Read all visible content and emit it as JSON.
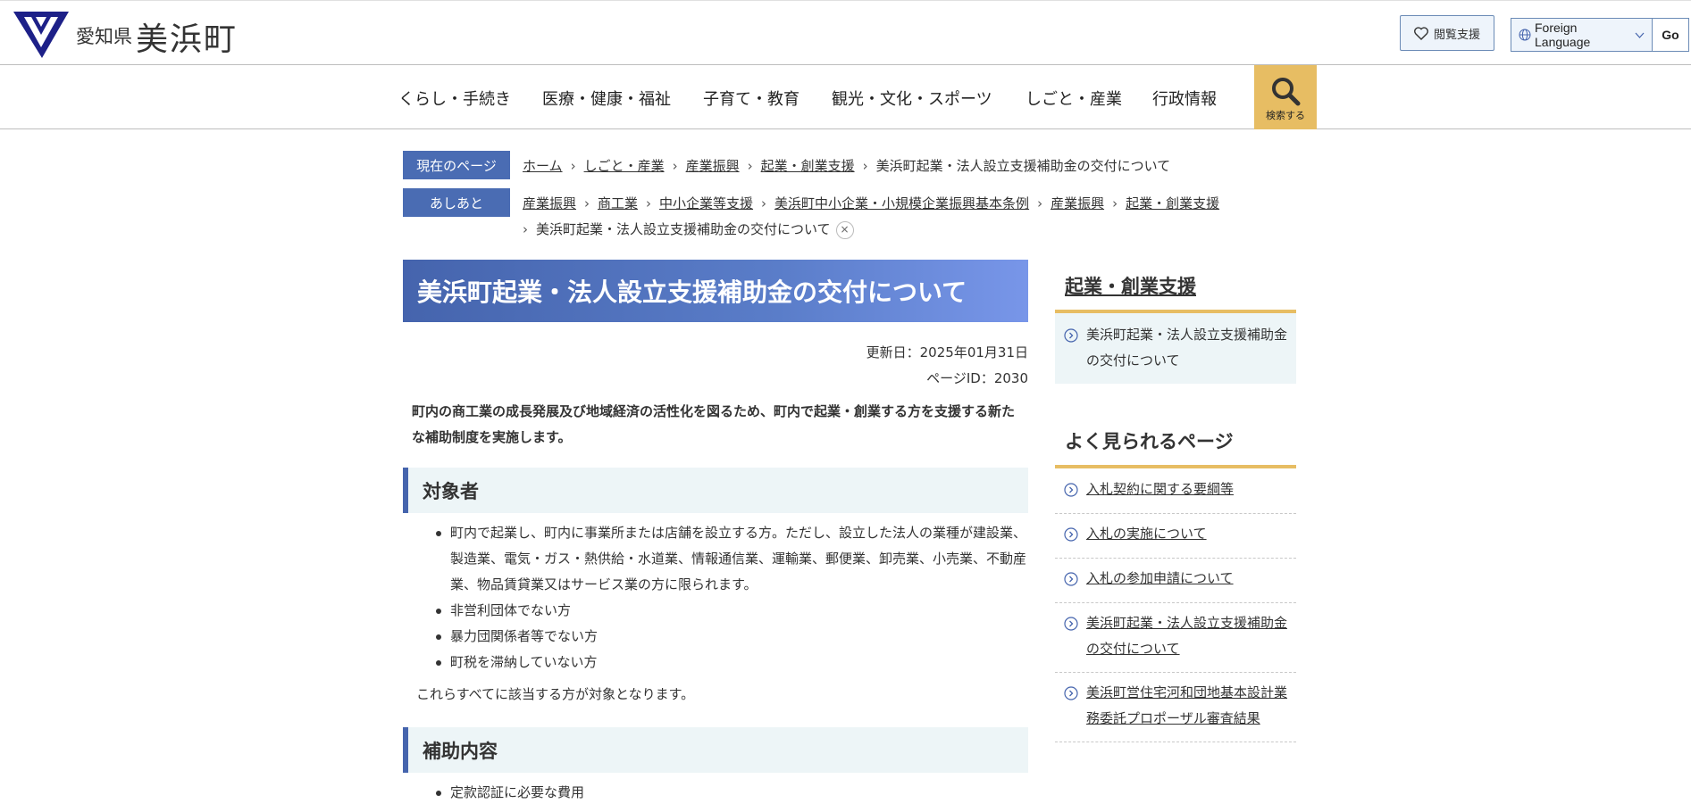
{
  "header": {
    "pref": "愛知県",
    "town": "美浜町",
    "reading_support": "閲覧支援",
    "lang_select": "Foreign Language",
    "lang_go": "Go",
    "brand_color": "#1d2088",
    "icons": [
      "town-emblem-logo",
      "heart-icon",
      "globe-icon",
      "chevron-down-icon",
      "search-icon"
    ]
  },
  "gnav": {
    "items": [
      "くらし・手続き",
      "医療・健康・福祉",
      "子育て・教育",
      "観光・文化・スポーツ",
      "しごと・産業",
      "行政情報"
    ],
    "search_label": "検索する",
    "search_color": "#e7bd63"
  },
  "breadcrumb": {
    "current_label": "現在のページ",
    "current": [
      "ホーム",
      "しごと・産業",
      "産業振興",
      "起業・創業支援"
    ],
    "current_page": "美浜町起業・法人設立支援補助金の交付について",
    "history_label": "あしあと",
    "history": [
      "産業振興",
      "商工業",
      "中小企業等支援",
      "美浜町中小企業・小規模企業振興基本条例",
      "産業振興",
      "起業・創業支援"
    ],
    "history_page": "美浜町起業・法人設立支援補助金の交付について",
    "close": "×",
    "label_color": "#4a6cb3"
  },
  "main": {
    "title": "美浜町起業・法人設立支援補助金の交付について",
    "updated": "更新日：2025年01月31日",
    "page_id": "ページID：2030",
    "lead": "町内の商工業の成長発展及び地域経済の活性化を図るため、町内で起業・創業する方を支援する新たな補助制度を実施します。",
    "section1": {
      "heading": "対象者",
      "items": [
        "町内で起業し、町内に事業所または店舗を設立する方。ただし、設立した法人の業種が建設業、製造業、電気・ガス・熱供給・水道業、情報通信業、運輸業、郵便業、卸売業、小売業、不動産業、物品賃貸業又はサービス業の方に限られます。",
        "非営利団体でない方",
        "暴力団関係者等でない方",
        "町税を滞納していない方"
      ],
      "note": "これらすべてに該当する方が対象となります。"
    },
    "section2": {
      "heading": "補助内容",
      "items": [
        "定款認証に必要な費用"
      ]
    }
  },
  "sidebar": {
    "category_title": "起業・創業支援",
    "category_current": "美浜町起業・法人設立支援補助金の交付について",
    "popular_title": "よく見られるページ",
    "popular": [
      "入札契約に関する要綱等",
      "入札の実施について",
      "入札の参加申請について",
      "美浜町起業・法人設立支援補助金の交付について",
      "美浜町営住宅河和団地基本設計業務委託プロポーザル審査結果"
    ],
    "accent_color": "#e7bd63"
  }
}
